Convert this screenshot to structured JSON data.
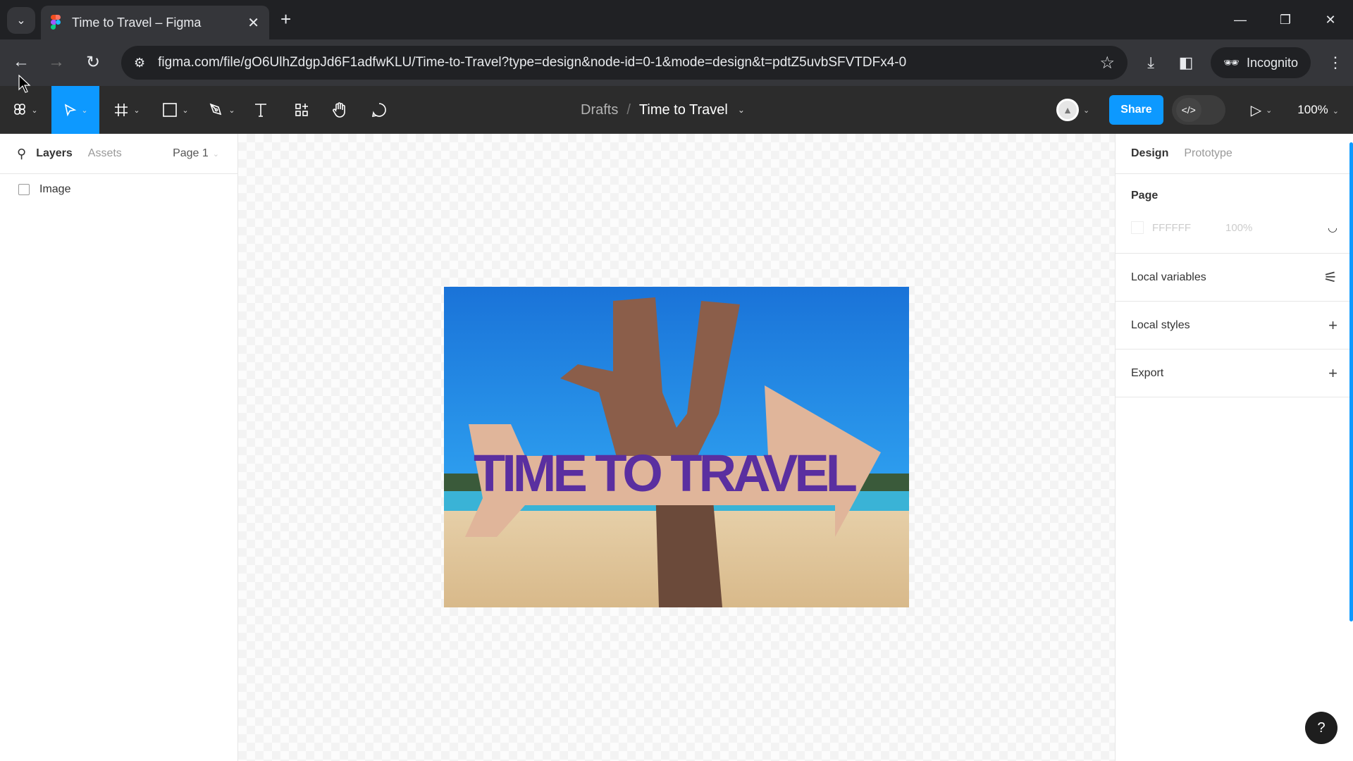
{
  "browser": {
    "tab_title": "Time to Travel – Figma",
    "url": "figma.com/file/gO6UlhZdgpJd6F1adfwKLU/Time-to-Travel?type=design&node-id=0-1&mode=design&t=pdtZ5uvbSFVTDFx4-0",
    "incognito_label": "Incognito"
  },
  "toolbar": {
    "breadcrumb_parent": "Drafts",
    "breadcrumb_separator": "/",
    "file_name": "Time to Travel",
    "share_label": "Share",
    "zoom_level": "100%",
    "accent_color": "#0d99ff",
    "tools": [
      "main-menu",
      "move",
      "frame",
      "shape",
      "pen",
      "text",
      "resources",
      "hand",
      "comment"
    ]
  },
  "left_panel": {
    "tabs": [
      "Layers",
      "Assets"
    ],
    "active_tab": "Layers",
    "page_selector": "Page 1",
    "layers": [
      {
        "name": "Image",
        "type": "image"
      }
    ]
  },
  "canvas": {
    "artwork": {
      "sign_text": "TIME TO TRAVEL",
      "description": "Wooden arrow signpost against blue sky and beach"
    }
  },
  "right_panel": {
    "tabs": [
      "Design",
      "Prototype"
    ],
    "active_tab": "Design",
    "page_section": {
      "title": "Page",
      "fill_hex": "FFFFFF",
      "fill_opacity": "100%"
    },
    "sections": [
      {
        "label": "Local variables",
        "action": "variables-icon"
      },
      {
        "label": "Local styles",
        "action": "plus-icon"
      },
      {
        "label": "Export",
        "action": "plus-icon"
      }
    ],
    "help_label": "?"
  }
}
